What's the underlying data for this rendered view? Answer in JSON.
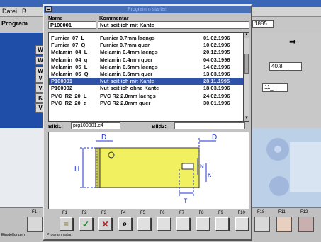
{
  "background": {
    "menu": [
      "Datei",
      "B"
    ],
    "left_label": "Program",
    "tabs": [
      "W",
      "W",
      "W",
      "V",
      "V",
      "K",
      "V"
    ],
    "right_field_1": "1885",
    "right_field_2": "40.8_",
    "right_field_3": "11_",
    "arrow": "➡"
  },
  "dialog": {
    "title": "Programm starten",
    "col_name": "Name",
    "col_comment": "Kommentar",
    "selected_name": "P100001",
    "selected_comment": "Nut seitlich mit Kante",
    "rows": [
      {
        "name": "Furnier_07_L",
        "comment": "Furnier 0.7mm laengs",
        "date": "01.02.1996"
      },
      {
        "name": "Furnier_07_Q",
        "comment": "Furnier 0.7mm quer",
        "date": "10.02.1996"
      },
      {
        "name": "Melamin_04_L",
        "comment": "Melamin 0.4mm laengs",
        "date": "20.12.1995"
      },
      {
        "name": "Melamin_04_q",
        "comment": "Melamin 0.4mm quer",
        "date": "04.03.1996"
      },
      {
        "name": "Melamin_05_L",
        "comment": "Melamin 0.5mm laengs",
        "date": "14.02.1996"
      },
      {
        "name": "Melamin_05_Q",
        "comment": "Melamin 0.5mm quer",
        "date": "13.03.1996"
      },
      {
        "name": "P100001",
        "comment": "Nut seitlich mit Kante",
        "date": "28.11.1995",
        "selected": true
      },
      {
        "name": "P100002",
        "comment": "Nut seitlich ohne Kante",
        "date": "18.03.1996"
      },
      {
        "name": "PVC_R2_20_L",
        "comment": "PVC R2 2.0mm laengs",
        "date": "24.02.1996"
      },
      {
        "name": "PVC_R2_20_q",
        "comment": "PVC R2 2.0mm quer",
        "date": "30.01.1996"
      }
    ],
    "bild1_label": "Bild1:",
    "bild1_value": "prg100001.c4",
    "bild2_label": "Bild2:",
    "bild2_value": "",
    "drawing_labels": {
      "d1": "D",
      "d2": "D",
      "h": "H",
      "n": "N",
      "k": "K",
      "t": "T"
    },
    "fkeys": [
      "F1",
      "F2",
      "F3",
      "F4",
      "F5",
      "F6",
      "F7",
      "F8",
      "F9",
      "F10"
    ],
    "fbuttons": [
      {
        "icon": "stack-icon",
        "glyph": "≡"
      },
      {
        "icon": "check-icon",
        "glyph": "✓"
      },
      {
        "icon": "cancel-icon",
        "glyph": "✕"
      },
      {
        "icon": "magnifier-icon",
        "glyph": "⌕"
      }
    ],
    "status": "Programmstart"
  },
  "toolbar": {
    "keys": [
      "F1",
      "F18",
      "F11",
      "F12"
    ],
    "status": "Einstellungen"
  },
  "colors": {
    "selection": "#2f52a8",
    "title_bar": "#4a70b8",
    "part_yellow": "#f0f060",
    "dim_blue": "#2030d0"
  }
}
